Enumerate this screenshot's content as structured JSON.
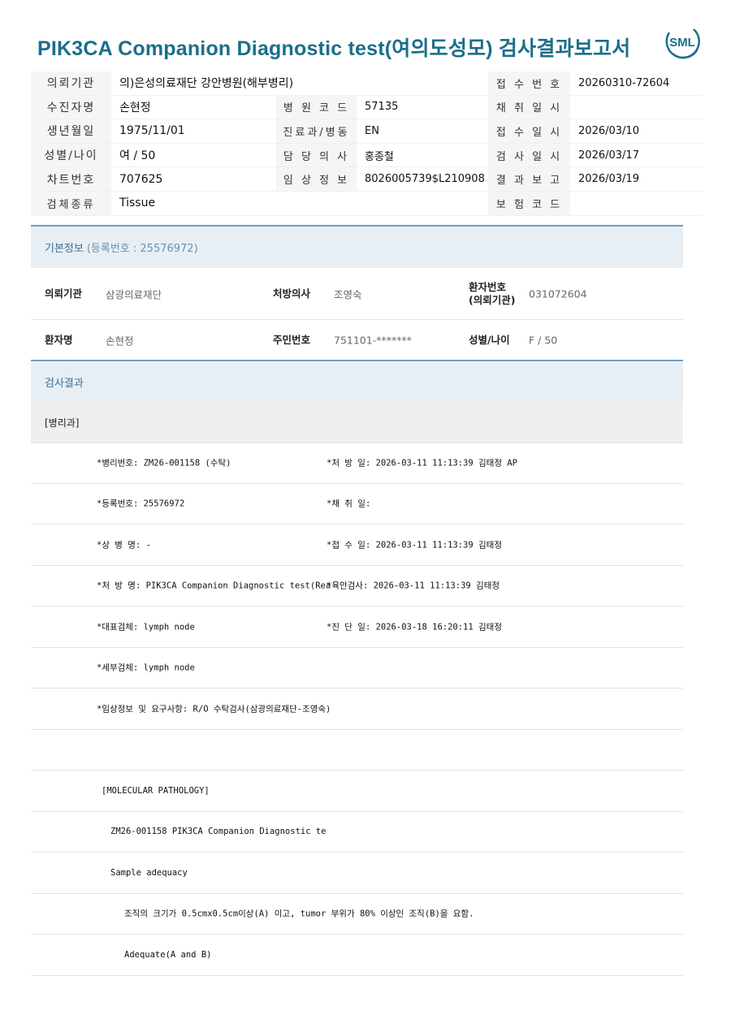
{
  "title": "PIK3CA Companion Diagnostic test(여의도성모) 검사결과보고서",
  "logo_text": "SML",
  "header": {
    "rows": [
      [
        {
          "l": "의뢰기관",
          "v": "의)은성의료재단 강안병원(해부병리)",
          "span": 3
        },
        {
          "l": "접 수 번 호",
          "v": "20260310-72604"
        }
      ],
      [
        {
          "l": "수진자명",
          "v": "손현정"
        },
        {
          "l": "병 원 코 드",
          "v": "57135"
        },
        {
          "l": "채 취 일 시",
          "v": ""
        }
      ],
      [
        {
          "l": "생년월일",
          "v": "1975/11/01"
        },
        {
          "l": "진료과/병동",
          "v": "EN"
        },
        {
          "l": "접 수 일 시",
          "v": "2026/03/10"
        }
      ],
      [
        {
          "l": "성별/나이",
          "v": "여 / 50"
        },
        {
          "l": "담 당 의 사",
          "v": "홍종철"
        },
        {
          "l": "검 사 일 시",
          "v": "2026/03/17"
        }
      ],
      [
        {
          "l": "차트번호",
          "v": "707625"
        },
        {
          "l": "임 상 정 보",
          "v": "8026005739$L210908"
        },
        {
          "l": "결 과 보 고",
          "v": "2026/03/19"
        }
      ],
      [
        {
          "l": "검체종류",
          "v": "Tissue",
          "span": 3
        },
        {
          "l": "보 험 코 드",
          "v": ""
        }
      ]
    ]
  },
  "basic": {
    "heading": "기본정보",
    "reg_label": "(등록번호 : 25576972)",
    "rows": [
      [
        {
          "k": "의뢰기관",
          "v": "삼광의료재단"
        },
        {
          "k": "처방의사",
          "v": "조영숙"
        },
        {
          "k": "환자번호\n(의뢰기관)",
          "v": "031072604"
        }
      ],
      [
        {
          "k": "환자명",
          "v": "손현정"
        },
        {
          "k": "주민번호",
          "v": "751101-*******"
        },
        {
          "k": "성별/나이",
          "v": "F / 50"
        }
      ]
    ]
  },
  "result": {
    "heading": "검사결과",
    "dept": "[병리과]",
    "lines": [
      {
        "a": "*병리번호: ZM26-001158 (수탁)",
        "b": "*처 방 일: 2026-03-11 11:13:39  김태정 AP"
      },
      {
        "a": "*등록번호: 25576972",
        "b": "*채 취 일:"
      },
      {
        "a": "*상 병 명: -",
        "b": "*접 수 일: 2026-03-11 11:13:39  김태정"
      },
      {
        "a": "*처 방 명: PIK3CA Companion Diagnostic test(Rea",
        "b": "*육안검사: 2026-03-11 11:13:39  김태정"
      },
      {
        "a": "*대표검체: lymph node",
        "b": "*진 단 일: 2026-03-18 16:20:11  김태정"
      },
      {
        "a": "*세부검체: lymph node",
        "b": ""
      },
      {
        "a": "*임상정보 및 요구사항: R/O 수탁검사(삼광의료재단-조영숙)",
        "b": ""
      },
      {
        "a": "",
        "b": ""
      },
      {
        "a": "[MOLECULAR PATHOLOGY]",
        "b": "",
        "indent": 1
      },
      {
        "a": "ZM26-001158     PIK3CA Companion Diagnostic te",
        "b": "",
        "indent": 2
      },
      {
        "a": "Sample adequacy",
        "b": "",
        "indent": 2
      },
      {
        "a": "조직의 크기가 0.5cmx0.5cm이상(A) 이고, tumor 부위가 80% 이상인 조직(B)을 요함.",
        "b": "",
        "indent": 3
      },
      {
        "a": "Adequate(A and B)",
        "b": "",
        "indent": 3
      }
    ]
  },
  "colors": {
    "title": "#1a6f8a",
    "section_border": "#6e9fc4",
    "section_bg": "#e8eff4",
    "label_bg": "#f3f5f7"
  }
}
